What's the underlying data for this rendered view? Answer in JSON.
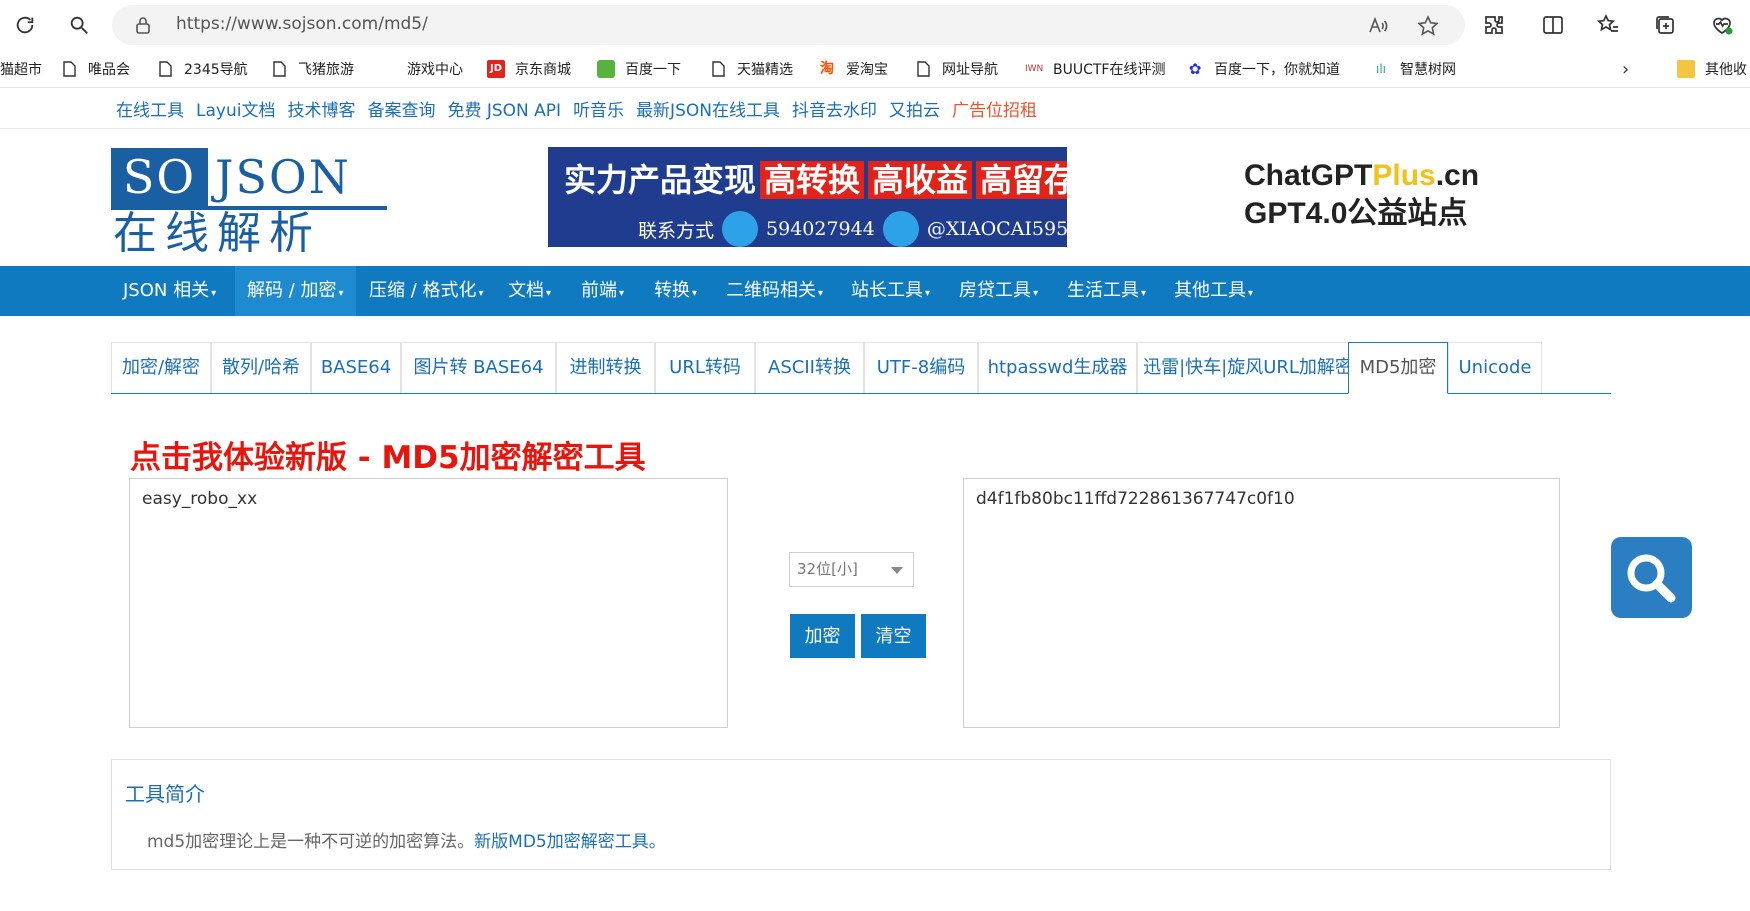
{
  "browser": {
    "url": "https://www.sojson.com/md5/",
    "bookmarks": [
      {
        "label": "猫超市"
      },
      {
        "label": "唯品会"
      },
      {
        "label": "2345导航"
      },
      {
        "label": "飞猪旅游"
      },
      {
        "label": "游戏中心"
      },
      {
        "label": "京东商城"
      },
      {
        "label": "百度一下"
      },
      {
        "label": "天猫精选"
      },
      {
        "label": "爱淘宝"
      },
      {
        "label": "网址导航"
      },
      {
        "label": "BUUCTF在线评测"
      },
      {
        "label": "百度一下，你就知道"
      },
      {
        "label": "智慧树网"
      },
      {
        "label": "其他收"
      }
    ]
  },
  "toplinks": [
    "在线工具",
    "Layui文档",
    "技术博客",
    "备案查询",
    "免费 JSON API",
    "听音乐",
    "最新JSON在线工具",
    "抖音去水印",
    "又拍云",
    "广告位招租"
  ],
  "logo": {
    "so": "SO",
    "json": "JSON",
    "cn": "在线解析"
  },
  "banner": {
    "headline_a": "实力产品变现",
    "headline_b": "高转换",
    "headline_c": "高收益",
    "headline_d": "高留存",
    "contact_label": "联系方式",
    "qq": "594027944",
    "telegram": "@XIAOCAI595"
  },
  "gptad": {
    "line1_a": "ChatGPT",
    "line1_b": "Plus",
    "line1_c": ".cn",
    "line2": "GPT4.0公益站点"
  },
  "mainnav": [
    "JSON 相关",
    "解码 / 加密",
    "压缩 / 格式化",
    "文档",
    "前端",
    "转换",
    "二维码相关",
    "站长工具",
    "房贷工具",
    "生活工具",
    "其他工具"
  ],
  "tabs": [
    "加密/解密",
    "散列/哈希",
    "BASE64",
    "图片转 BASE64",
    "进制转换",
    "URL转码",
    "ASCII转换",
    "UTF-8编码",
    "htpasswd生成器",
    "迅雷|快车|旋风URL加解密",
    "MD5加密",
    "Unicode"
  ],
  "tool": {
    "promo": "点击我体验新版 - MD5加密解密工具",
    "input_value": "easy_robo_xx",
    "output_value": "d4f1fb80bc11ffd722861367747c0f10",
    "bits_option": "32位[小]",
    "encrypt_label": "加密",
    "clear_label": "清空"
  },
  "intro": {
    "title": "工具简介",
    "desc": "md5加密理论上是一种不可逆的加密算法。",
    "link": "新版MD5加密解密工具。"
  },
  "colors": {
    "nav_bg": "#0f7ac0",
    "link": "#1a6fb8",
    "promo_red": "#e8150d"
  }
}
